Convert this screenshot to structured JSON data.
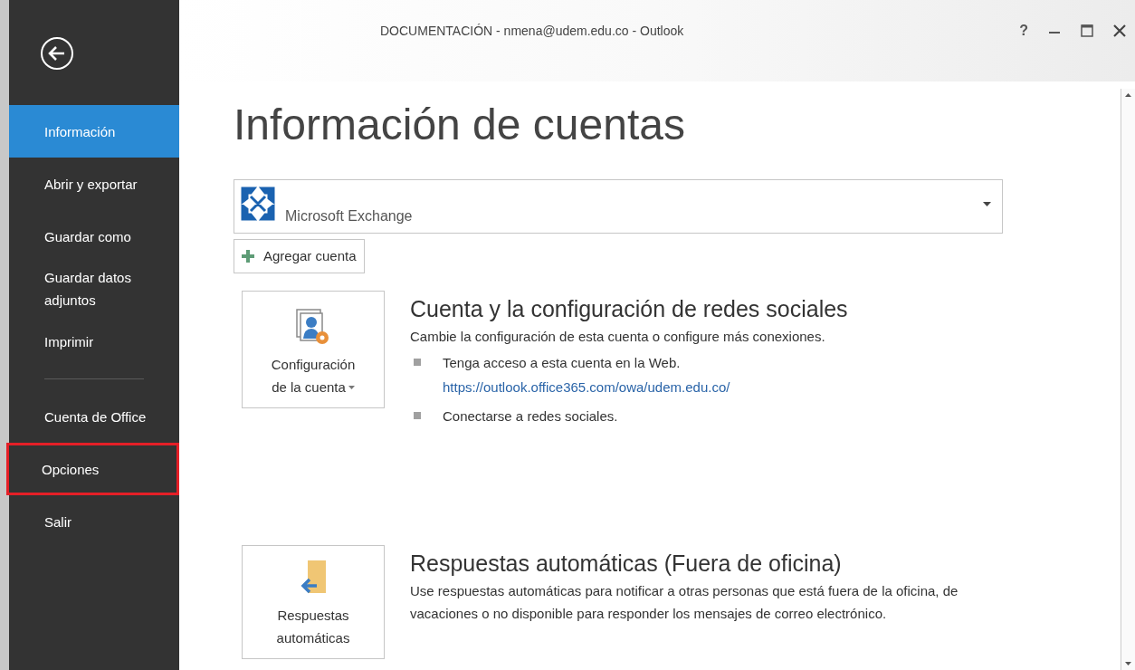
{
  "window": {
    "title": "DOCUMENTACIÓN - nmena@udem.edu.co - Outlook",
    "help_label": "?"
  },
  "sidebar": {
    "items": [
      {
        "kind": "item",
        "label": "Información",
        "selected": true,
        "highlighted": false
      },
      {
        "kind": "item",
        "label": "Abrir y exportar",
        "selected": false,
        "highlighted": false
      },
      {
        "kind": "item",
        "label": "Guardar como",
        "selected": false,
        "highlighted": false
      },
      {
        "kind": "item",
        "label": "Guardar datos adjuntos",
        "selected": false,
        "highlighted": false
      },
      {
        "kind": "item",
        "label": "Imprimir",
        "selected": false,
        "highlighted": false
      },
      {
        "kind": "separator"
      },
      {
        "kind": "item",
        "label": "Cuenta de Office",
        "selected": false,
        "highlighted": false
      },
      {
        "kind": "item",
        "label": "Opciones",
        "selected": false,
        "highlighted": true
      },
      {
        "kind": "item",
        "label": "Salir",
        "selected": false,
        "highlighted": false
      }
    ]
  },
  "heading": "Información de cuentas",
  "account": {
    "name": "Microsoft Exchange"
  },
  "add_account": "Agregar cuenta",
  "sections": [
    {
      "kind": "settings",
      "button": [
        "Configuración",
        "de la cuenta"
      ],
      "has_caret": true,
      "title": "Cuenta y la configuración de redes sociales",
      "description": "Cambie la configuración de esta cuenta o configure más conexiones.",
      "bullets": [
        {
          "text": "Tenga acceso a esta cuenta en la Web.",
          "link": "https://outlook.office365.com/owa/udem.edu.co/"
        },
        {
          "text": "Conectarse a redes sociales."
        }
      ]
    },
    {
      "kind": "autoreply",
      "button": [
        "Respuestas",
        "automáticas"
      ],
      "has_caret": false,
      "title": "Respuestas automáticas (Fuera de oficina)",
      "description": "Use respuestas automáticas para notificar a otras personas que está fuera de la oficina, de vacaciones o no disponible para responder los mensajes de correo electrónico."
    }
  ]
}
